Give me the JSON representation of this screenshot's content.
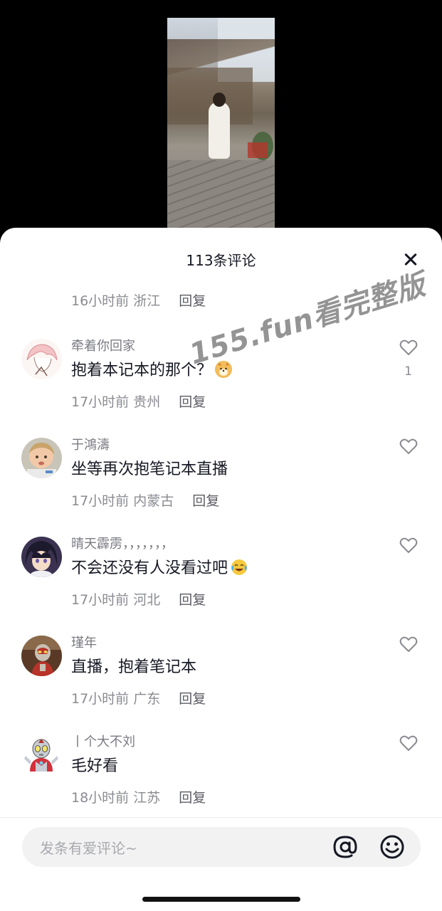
{
  "header": {
    "title": "113条评论"
  },
  "top_comment_meta": {
    "time": "16小时前",
    "location": "浙江",
    "reply": "回复"
  },
  "comments": [
    {
      "name": "牵着你回家",
      "text": "抱着本记本的那个？",
      "time": "17小时前",
      "location": "贵州",
      "reply": "回复",
      "likes": "1",
      "emoji": "doge-emoji"
    },
    {
      "name": "于鴻濤",
      "text": "坐等再次抱笔记本直播",
      "time": "17小时前",
      "location": "内蒙古",
      "reply": "回复",
      "likes": ""
    },
    {
      "name": "晴天霹雳，，，，，，，",
      "text": "不会还没有人没看过吧",
      "time": "17小时前",
      "location": "河北",
      "reply": "回复",
      "likes": "",
      "emoji": "laugh-cry-emoji"
    },
    {
      "name": "瑾年",
      "text": "直播，抱着笔记本",
      "time": "17小时前",
      "location": "广东",
      "reply": "回复",
      "likes": ""
    },
    {
      "name": "丨个大不刘",
      "text": "毛好看",
      "time": "18小时前",
      "location": "江苏",
      "reply": "回复",
      "likes": ""
    }
  ],
  "watermark": "155.fun看完整版",
  "input": {
    "placeholder": "发条有爱评论~"
  },
  "icons": {
    "close": "close-icon",
    "like": "heart-outline-icon",
    "mention": "at-icon",
    "emoji": "smiley-icon"
  },
  "colors": {
    "text_primary": "#161823",
    "text_secondary": "#8a8b91",
    "sheet_bg": "#ffffff"
  }
}
